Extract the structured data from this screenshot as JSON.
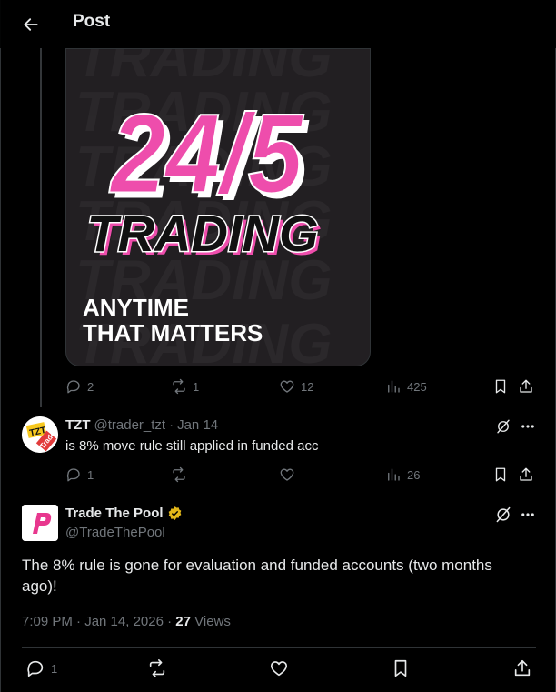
{
  "header": {
    "title": "Post",
    "back_icon": "arrow-left-icon"
  },
  "media": {
    "headline": "24/5",
    "subhead": "TRADING",
    "tagline_1": "ANYTIME",
    "tagline_2": "THAT MATTERS",
    "background_word": "TRADING",
    "colors": {
      "pink": "#ee4dac",
      "bg": "#221f22"
    }
  },
  "quoted_actions": {
    "replies": "2",
    "reposts": "1",
    "likes": "12",
    "views": "425"
  },
  "reply": {
    "name": "TZT",
    "handle": "@trader_tzt",
    "separator": "·",
    "date": "Jan 14",
    "text": "is 8% move rule still applied in funded acc",
    "avatar_text_1": "TZT",
    "avatar_text_2": "Trade",
    "actions": {
      "replies": "1",
      "reposts": "",
      "likes": "",
      "views": "26"
    }
  },
  "post": {
    "name": "Trade The Pool",
    "handle": "@TradeThePool",
    "verified": true,
    "text": "The 8% rule is gone for evaluation and funded accounts (two months ago)!",
    "time": "7:09 PM · Jan 14, 2026 ·",
    "views_count": "27",
    "views_label": "Views",
    "actions": {
      "replies": "1"
    },
    "brand_color": "#e8378e"
  }
}
